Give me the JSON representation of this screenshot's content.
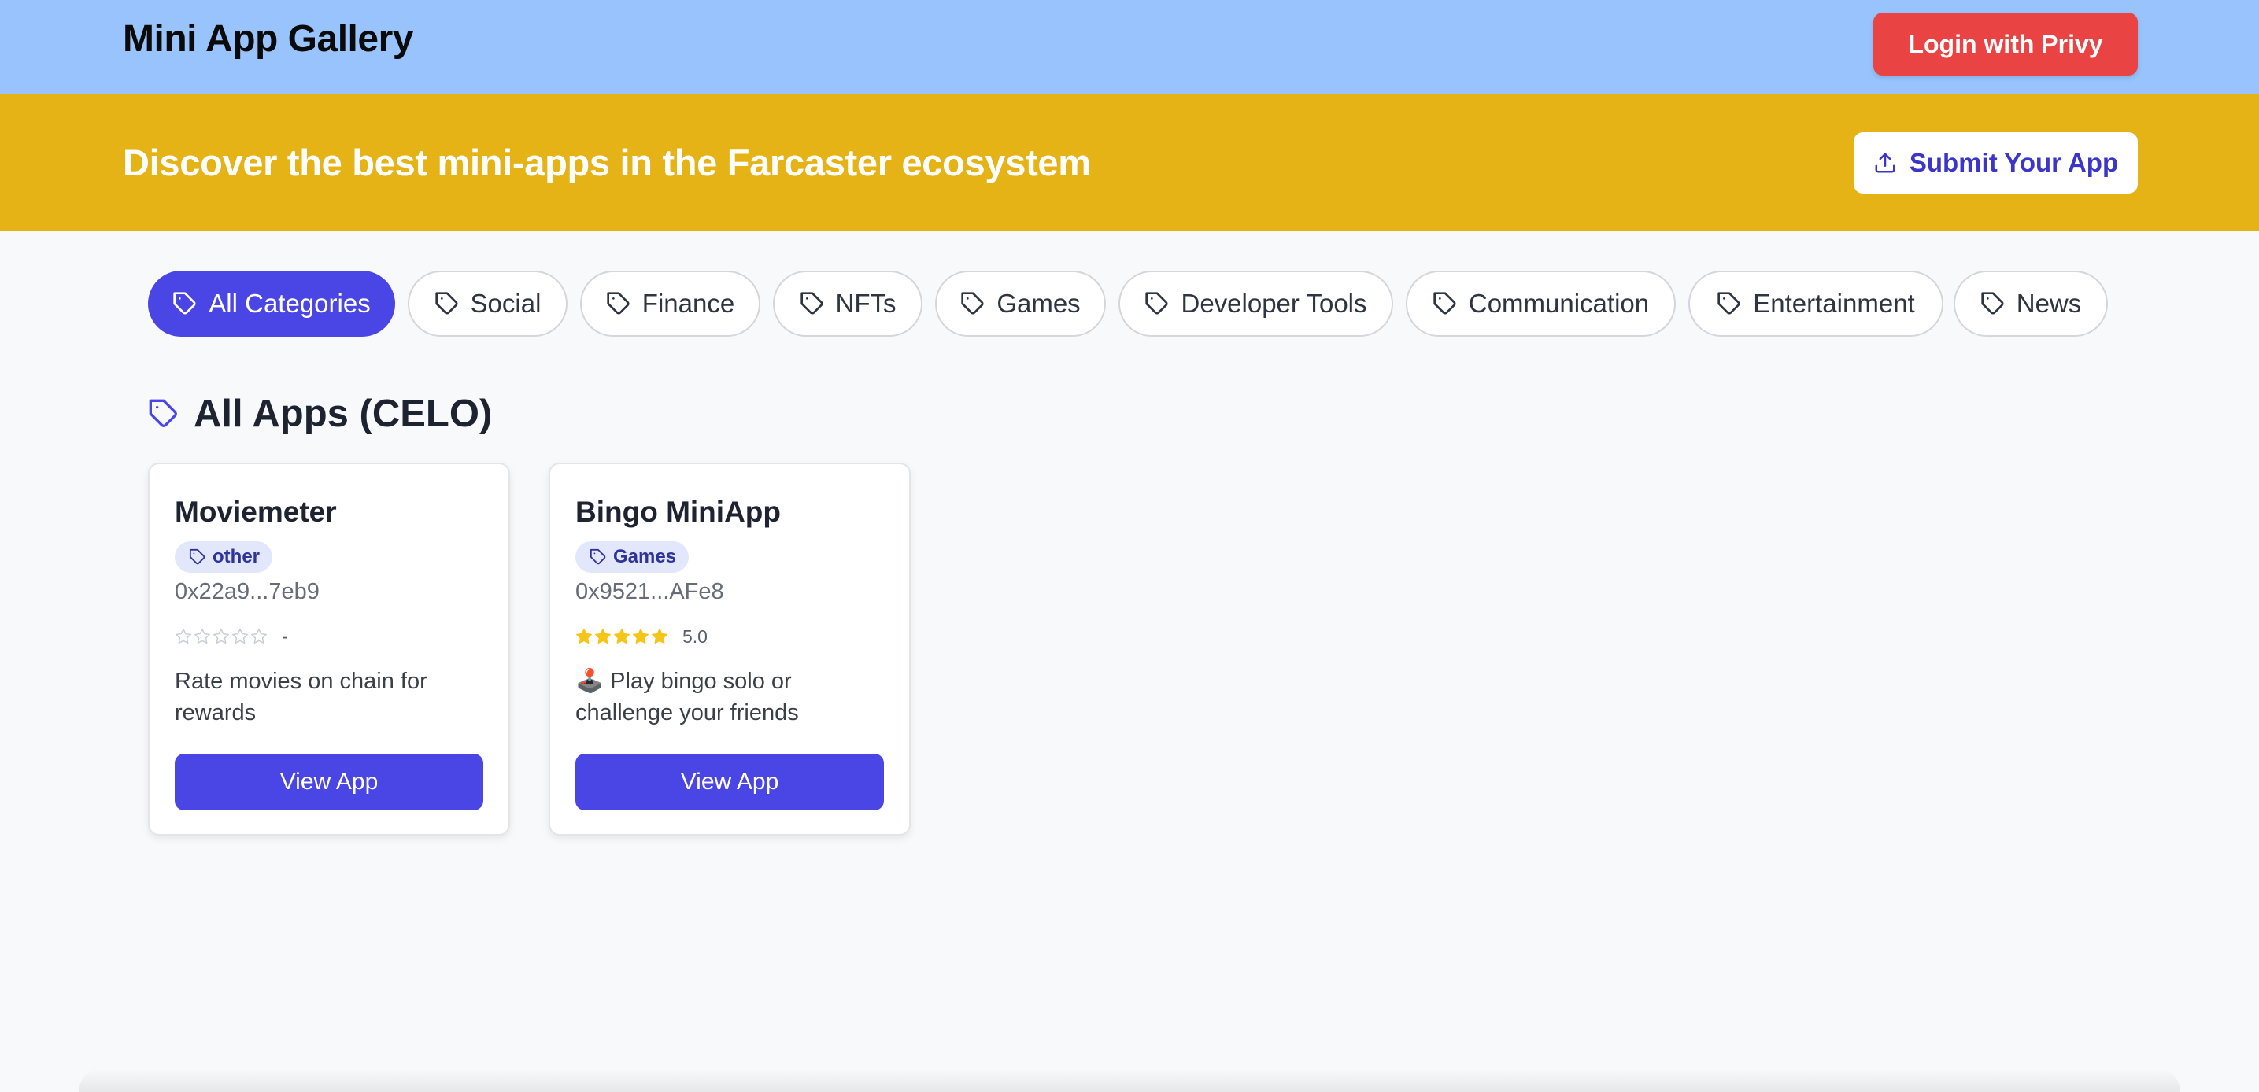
{
  "header": {
    "brand": "Mini App Gallery",
    "login_label": "Login with Privy"
  },
  "hero": {
    "headline": "Discover the best mini-apps in the Farcaster ecosystem",
    "submit_label": "Submit Your App"
  },
  "categories": [
    {
      "label": "All Categories",
      "active": true
    },
    {
      "label": "Social",
      "active": false
    },
    {
      "label": "Finance",
      "active": false
    },
    {
      "label": "NFTs",
      "active": false
    },
    {
      "label": "Games",
      "active": false
    },
    {
      "label": "Developer Tools",
      "active": false
    },
    {
      "label": "Communication",
      "active": false
    },
    {
      "label": "Entertainment",
      "active": false
    },
    {
      "label": "News",
      "active": false
    }
  ],
  "section": {
    "title": "All Apps (CELO)"
  },
  "apps": [
    {
      "name": "Moviemeter",
      "category": "other",
      "address": "0x22a9...7eb9",
      "rating": 0,
      "rating_text": "-",
      "description": "Rate movies on chain for rewards",
      "button_label": "View App"
    },
    {
      "name": "Bingo MiniApp",
      "category": "Games",
      "address": "0x9521...AFe8",
      "rating": 5,
      "rating_text": "5.0",
      "description": "🕹️ Play bingo solo or challenge your friends",
      "button_label": "View App"
    }
  ],
  "colors": {
    "header_bg": "#98c3fc",
    "hero_bg": "#e5b315",
    "login_bg": "#ea4343",
    "accent": "#4a45e5",
    "star_filled": "#f5c518",
    "star_empty": "#c9ccd3"
  },
  "icons": {
    "category_pill": "tag-icon",
    "section_title": "tag-icon",
    "submit": "upload-icon",
    "rating": "star-icon"
  }
}
